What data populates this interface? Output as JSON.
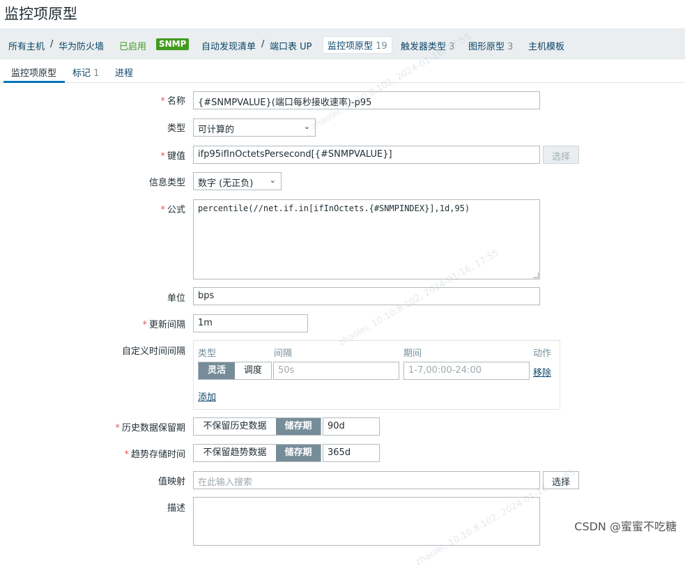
{
  "page": {
    "title": "监控项原型"
  },
  "nav": {
    "all_hosts": "所有主机",
    "sep": "/",
    "host": "华为防火墙",
    "status": "已启用",
    "snmp_badge": "SNMP",
    "discovery": "自动发现清单",
    "discovery_rule": "端口表 UP",
    "item_proto_label": "监控项原型",
    "item_proto_count": "19",
    "trigger_label": "触发器类型",
    "trigger_count": "3",
    "graph_label": "图形原型",
    "graph_count": "3",
    "host_proto": "主机模板"
  },
  "tabs": {
    "item_proto": "监控项原型",
    "tags_label": "标记",
    "tags_count": "1",
    "preprocessing": "进程"
  },
  "form": {
    "name_label": "名称",
    "name_value": "{#SNMPVALUE}(端口每秒接收速率)-p95",
    "type_label": "类型",
    "type_value": "可计算的",
    "key_label": "键值",
    "key_value": "ifp95ifInOctetsPersecond[{#SNMPVALUE}]",
    "select_btn": "选择",
    "info_type_label": "信息类型",
    "info_type_value": "数字 (无正负)",
    "formula_label": "公式",
    "formula_value": "percentile(//net.if.in[ifInOctets.{#SNMPINDEX}],1d,95)",
    "units_label": "单位",
    "units_value": "bps",
    "interval_label": "更新间隔",
    "interval_value": "1m",
    "custom_label": "自定义时间间隔",
    "custom": {
      "col_type": "类型",
      "col_interval": "间隔",
      "col_period": "期间",
      "col_action": "动作",
      "flexible": "灵活",
      "scheduling": "调度",
      "interval_placeholder": "50s",
      "period_placeholder": "1-7,00:00-24:00",
      "remove": "移除",
      "add": "添加"
    },
    "history_label": "历史数据保留期",
    "history_off": "不保留历史数据",
    "history_on": "储存期",
    "history_value": "90d",
    "trends_label": "趋势存储时间",
    "trends_off": "不保留趋势数据",
    "trends_on": "储存期",
    "trends_value": "365d",
    "valuemap_label": "值映射",
    "valuemap_placeholder": "在此输入搜索",
    "valuemap_btn": "选择",
    "desc_label": "描述"
  },
  "watermarks": [
    "zhaolei, 10.10.8.102, 2024-01-16, 17:55"
  ],
  "footer": {
    "csdn": "CSDN @蜜蜜不吃糖"
  },
  "colors": {
    "accent": "#0275b8",
    "link": "#0a466a",
    "enabled": "#429a1f",
    "required": "#e45959",
    "segment_active": "#768d99"
  }
}
